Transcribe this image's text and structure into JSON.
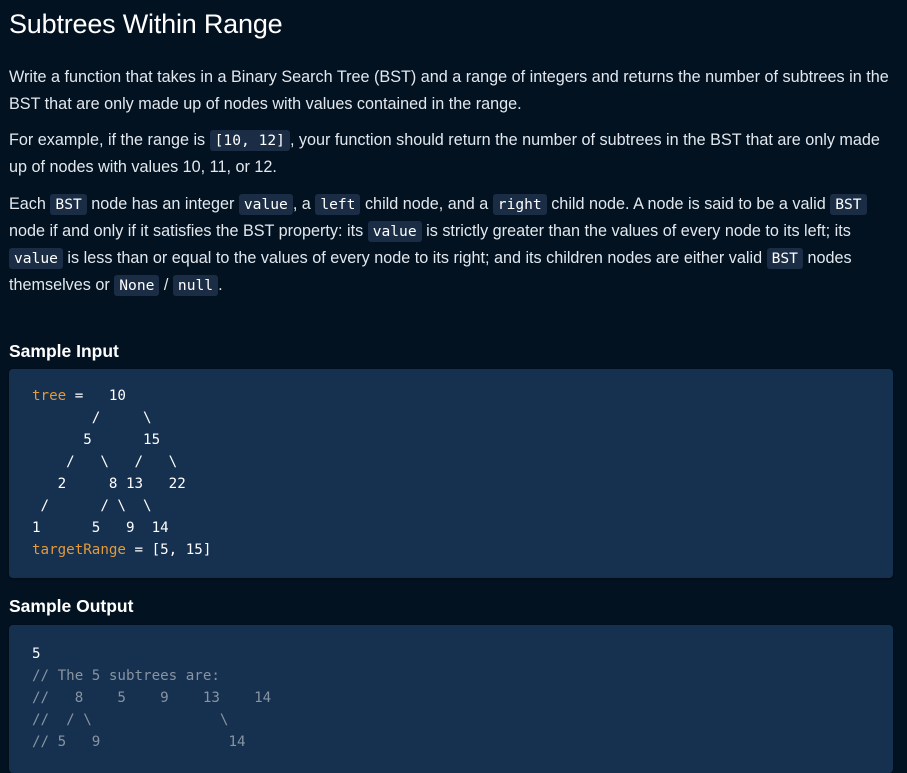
{
  "title": "Subtrees Within Range",
  "paragraph1": "Write a function that takes in a Binary Search Tree (BST) and a range of integers and returns the number of subtrees in the BST that are only made up of nodes with values contained in the range.",
  "paragraph2": {
    "before": "For example, if the range is ",
    "code": "[10, 12]",
    "after": ", your function should return the number of subtrees in the BST that are only made up of nodes with values 10, 11, or 12."
  },
  "paragraph3": {
    "t1": "Each ",
    "c1": "BST",
    "t2": " node has an integer ",
    "c2": "value",
    "t3": ", a ",
    "c3": "left",
    "t4": " child node, and a ",
    "c4": "right",
    "t5": " child node. A node is said to be a valid ",
    "c5": "BST",
    "t6": " node if and only if it satisfies the BST property: its ",
    "c6": "value",
    "t7": " is strictly greater than the values of every node to its left; its ",
    "c7": "value",
    "t8": " is less than or equal to the values of every node to its right; and its children nodes are either valid ",
    "c8": "BST",
    "t9": " nodes themselves or ",
    "c9": "None",
    "t10": " / ",
    "c10": "null",
    "t11": "."
  },
  "sample_input": {
    "heading": "Sample Input",
    "tree_var": "tree",
    "tree_first_rest": " =   10",
    "tree_lines": [
      "       /     \\",
      "      5      15",
      "    /   \\   /   \\",
      "   2     8 13   22",
      " /      / \\  \\",
      "1      5   9  14"
    ],
    "range_var": "targetRange",
    "range_rest": " = [5, 15]"
  },
  "sample_output": {
    "heading": "Sample Output",
    "result": "5",
    "comment_lines": [
      "// The 5 subtrees are:",
      "//   8    5    9    13    14",
      "//  / \\               \\",
      "// 5   9               14"
    ]
  },
  "colors": {
    "background": "#021221",
    "code_block": "#16304f",
    "inline_code": "#1b2d45",
    "variable": "#e29a3a",
    "comment": "#8794a2"
  }
}
